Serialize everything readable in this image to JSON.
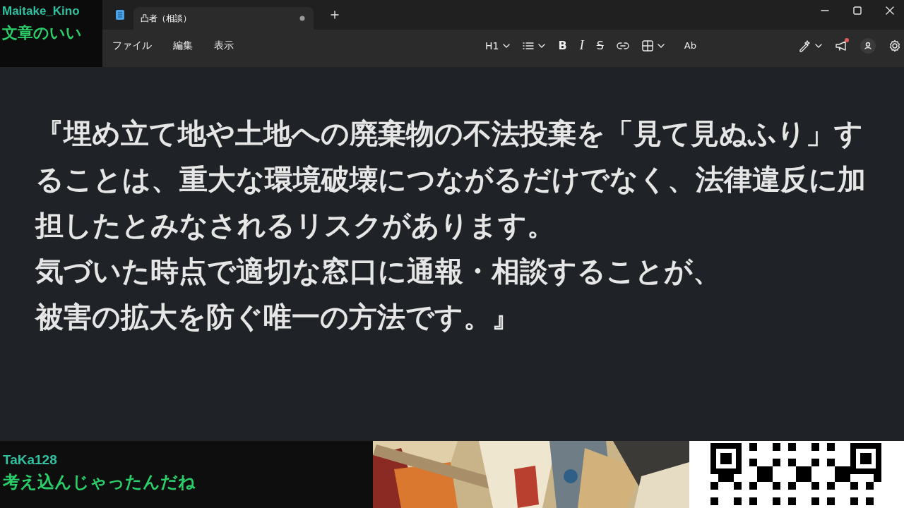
{
  "chat_top": {
    "user": "Maitake_Kino",
    "message": "文章のいい"
  },
  "window": {
    "tab": {
      "title": "凸者（相談）",
      "unsaved": true,
      "selected": true
    },
    "menu": [
      "ファイル",
      "編集",
      "表示"
    ],
    "toolbar": [
      {
        "kind": "dropdown",
        "label": "H1"
      },
      {
        "kind": "list"
      },
      {
        "kind": "bold",
        "label": "B"
      },
      {
        "kind": "italic",
        "label": "I"
      },
      {
        "kind": "strike",
        "label": "S"
      },
      {
        "kind": "link"
      },
      {
        "kind": "table"
      },
      {
        "kind": "spell",
        "label": "Ab"
      }
    ],
    "toolbar_right": [
      {
        "kind": "copilot"
      },
      {
        "kind": "megaphone",
        "notification": true
      },
      {
        "kind": "avatar"
      },
      {
        "kind": "settings"
      }
    ]
  },
  "document": {
    "lines": [
      "『埋め立て地や土地への廃棄物の不法投棄を「見て見ぬふり」することは、重大な環境破壊につながるだけでなく、法律違反に加担したとみなされるリスクがあります。",
      "気づいた時点で適切な窓口に通報・相談することが、",
      "被害の拡大を防ぐ唯一の方法です。』"
    ]
  },
  "chat_bottom": {
    "user": "TaKa128",
    "message": "考え込んじゃったんだね"
  },
  "panels": [
    {
      "kind": "picture"
    },
    {
      "kind": "qr"
    }
  ]
}
